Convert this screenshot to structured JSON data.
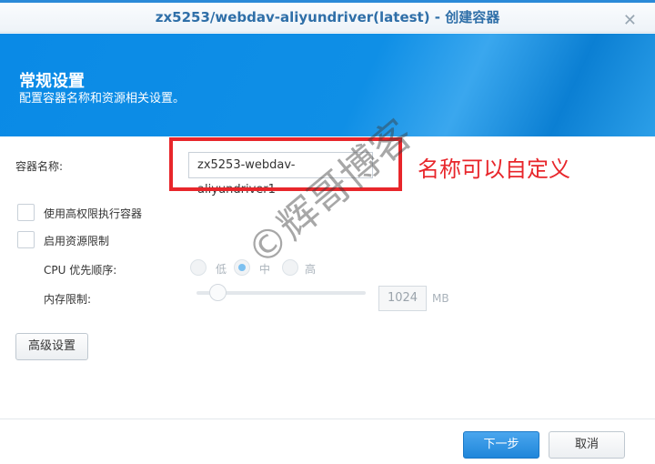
{
  "window": {
    "title": "zx5253/webdav-aliyundriver(latest) - 创建容器",
    "close": "✕"
  },
  "banner": {
    "title": "常规设置",
    "subtitle": "配置容器名称和资源相关设置。"
  },
  "form": {
    "name_label": "容器名称:",
    "name_value": "zx5253-webdav-aliyundriver1",
    "annotation": "名称可以自定义",
    "privileged_label": "使用高权限执行容器",
    "resource_limit_label": "启用资源限制",
    "cpu_label": "CPU 优先顺序:",
    "cpu_options": [
      "低",
      "中",
      "高"
    ],
    "cpu_selected": "中",
    "memory_label": "内存限制:",
    "memory_value": "1024",
    "memory_unit": "MB",
    "advanced_button": "高级设置"
  },
  "footer": {
    "next": "下一步",
    "cancel": "取消"
  },
  "watermark": "©辉哥博客"
}
